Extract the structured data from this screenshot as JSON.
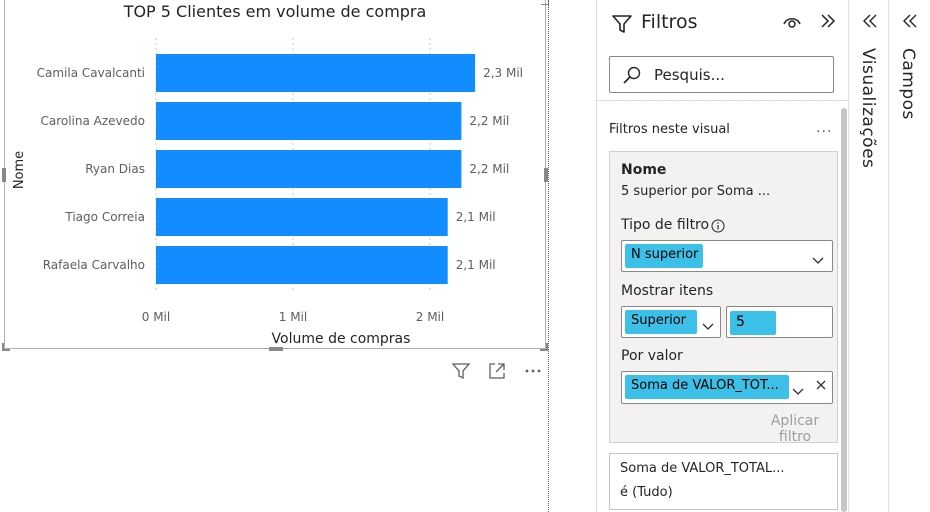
{
  "chart": {
    "title": "TOP 5 Clientes em volume de compra",
    "axis_label_x": "Volume de compras",
    "axis_label_y": "Nome",
    "bar_color": "#118DFF"
  },
  "chart_data": {
    "type": "bar",
    "orientation": "horizontal",
    "title": "TOP 5 Clientes em volume de compra",
    "xlabel": "Volume de compras",
    "ylabel": "Nome",
    "categories": [
      "Camila Cavalcanti",
      "Carolina Azevedo",
      "Ryan Dias",
      "Tiago Correia",
      "Rafaela Carvalho"
    ],
    "values": [
      2300,
      2200,
      2200,
      2100,
      2100
    ],
    "value_labels": [
      "2,3 Mil",
      "2,2 Mil",
      "2,2 Mil",
      "2,1 Mil",
      "2,1 Mil"
    ],
    "xlim": [
      0,
      2500
    ],
    "x_ticks": [
      0,
      1000,
      2000
    ],
    "x_tick_labels": [
      "0 Mil",
      "1 Mil",
      "2 Mil"
    ],
    "grid": true
  },
  "visual_actions": {
    "filter_icon": "filter-icon",
    "focus_icon": "focus-mode-icon",
    "more_icon": "more-options-icon"
  },
  "filters": {
    "title": "Filtros",
    "search_placeholder": "Pesquis...",
    "section_label": "Filtros neste visual",
    "section_more": "...",
    "card": {
      "name": "Nome",
      "summary": "5 superior por Soma ...",
      "filter_type_label": "Tipo de filtro",
      "filter_type_value": "N superior",
      "show_items_label": "Mostrar itens",
      "direction_value": "Superior",
      "count_value": "5",
      "by_value_label": "Por valor",
      "by_value_value": "Soma de VALOR_TOT...",
      "apply_label": "Aplicar filtro"
    },
    "card2": {
      "name": "Soma de VALOR_TOTAL...",
      "summary": "é (Tudo)"
    }
  },
  "panes": {
    "visualizations": "Visualizações",
    "fields": "Campos"
  },
  "colors": {
    "accent": "#118DFF",
    "highlight": "#3CC0E8"
  }
}
